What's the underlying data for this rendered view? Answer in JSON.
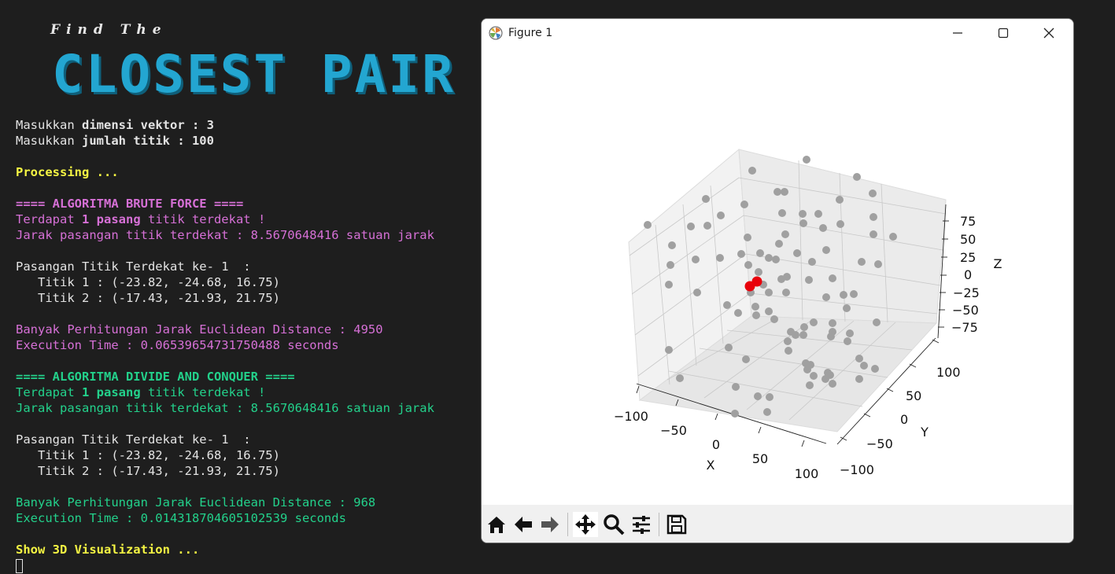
{
  "terminal": {
    "tagline": "Find The",
    "banner": "CLOSEST PAIR",
    "prompt_dimension": {
      "prefix": "Masukkan ",
      "bold": "dimensi vektor",
      "suffix": " : 3"
    },
    "prompt_points": {
      "prefix": "Masukkan ",
      "bold": "jumlah titik",
      "suffix": " : 100"
    },
    "processing": "Processing ...",
    "brute_force": {
      "header": "==== ALGORITMA BRUTE FORCE ====",
      "found_prefix": "Terdapat ",
      "found_bold": "1 pasang",
      "found_suffix": " titik terdekat !",
      "distance": "Jarak pasangan titik terdekat : 8.5670648416 satuan jarak",
      "pair_title": "Pasangan Titik Terdekat ke- 1  :",
      "point1": "   Titik 1 : (-23.82, -24.68, 16.75)",
      "point2": "   Titik 2 : (-17.43, -21.93, 21.75)",
      "count": "Banyak Perhitungan Jarak Euclidean Distance : 4950",
      "time": "Execution Time : 0.06539654731750488 seconds"
    },
    "divide_conquer": {
      "header": "==== ALGORITMA DIVIDE AND CONQUER ====",
      "found_prefix": "Terdapat ",
      "found_bold": "1 pasang",
      "found_suffix": " titik terdekat !",
      "distance": "Jarak pasangan titik terdekat : 8.5670648416 satuan jarak",
      "pair_title": "Pasangan Titik Terdekat ke- 1  :",
      "point1": "   Titik 1 : (-23.82, -24.68, 16.75)",
      "point2": "   Titik 2 : (-17.43, -21.93, 21.75)",
      "count": "Banyak Perhitungan Jarak Euclidean Distance : 968",
      "time": "Execution Time : 0.014318704605102539 seconds"
    },
    "show_viz": "Show 3D Visualization ..."
  },
  "figure_window": {
    "title": "Figure 1",
    "icon": "matplotlib-icon",
    "controls": [
      "minimize-icon",
      "maximize-icon",
      "close-icon"
    ],
    "plot": {
      "x_label": "X",
      "y_label": "Y",
      "z_label": "Z",
      "x_ticks": [
        "−100",
        "−50",
        "0",
        "50",
        "100"
      ],
      "y_ticks": [
        "−100",
        "−50",
        "0",
        "50",
        "100"
      ],
      "z_ticks": [
        "−75",
        "−50",
        "−25",
        "0",
        "25",
        "50",
        "75"
      ],
      "point_color": "#a0a0a0",
      "highlight_color": "#e8000b"
    },
    "toolbar": [
      "home-icon",
      "back-icon",
      "forward-icon",
      "pan-icon",
      "zoom-icon",
      "configure-subplots-icon",
      "save-icon"
    ]
  },
  "colors": {
    "background": "#1e1e1e",
    "banner": "#23a6d1",
    "yellow": "#f5f543",
    "magenta": "#d670d6",
    "green": "#23d18b",
    "white": "#e3e3e3"
  }
}
